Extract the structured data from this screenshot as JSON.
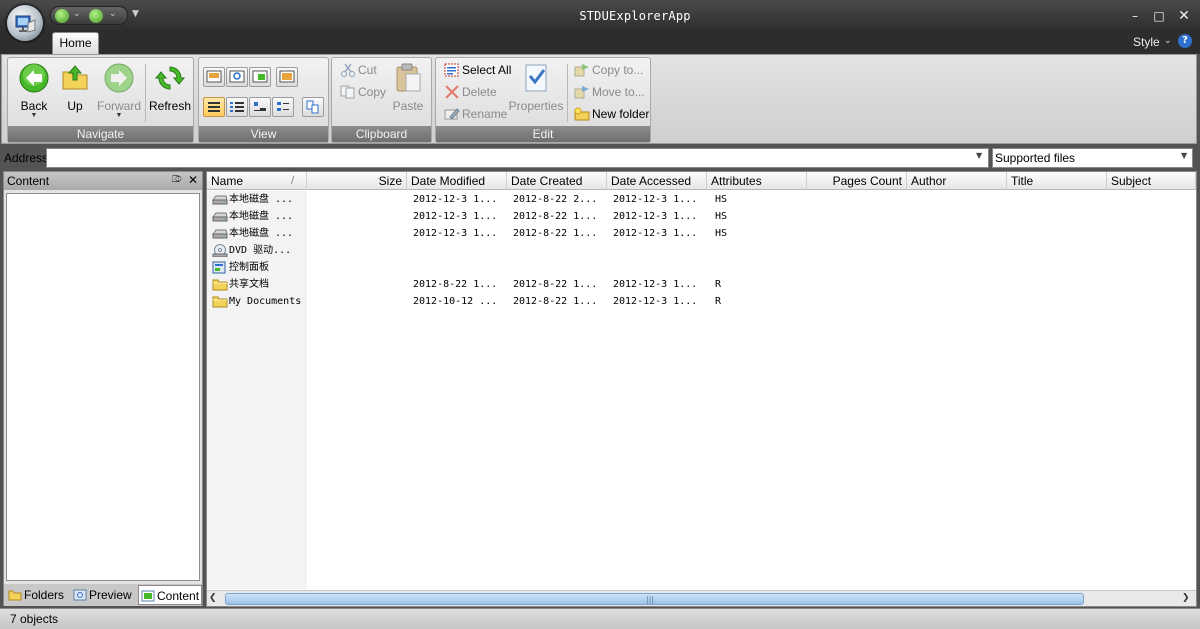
{
  "window": {
    "title": "STDUExplorerApp"
  },
  "ribbon": {
    "tabs": [
      {
        "label": "Home"
      }
    ],
    "style_menu": "Style",
    "groups": {
      "navigate": {
        "label": "Navigate",
        "back": "Back",
        "up": "Up",
        "forward": "Forward",
        "refresh": "Refresh"
      },
      "view": {
        "label": "View"
      },
      "clipboard": {
        "label": "Clipboard",
        "cut": "Cut",
        "copy": "Copy",
        "paste": "Paste"
      },
      "edit": {
        "label": "Edit",
        "select_all": "Select All",
        "delete": "Delete",
        "rename": "Rename",
        "properties": "Properties",
        "copy_to": "Copy to...",
        "move_to": "Move to...",
        "new_folder": "New folder"
      }
    }
  },
  "address": {
    "label": "Address",
    "value": "",
    "filter": "Supported files"
  },
  "left_panel": {
    "title": "Content",
    "tabs": [
      {
        "label": "Folders"
      },
      {
        "label": "Preview"
      },
      {
        "label": "Content"
      }
    ]
  },
  "list": {
    "columns": [
      "Name",
      "Size",
      "Date Modified",
      "Date Created",
      "Date Accessed",
      "Attributes",
      "Pages Count",
      "Author",
      "Title",
      "Subject"
    ],
    "rows": [
      {
        "name": "本地磁盘 ...",
        "size": "",
        "modified": "2012-12-3 1...",
        "created": "2012-8-22 2...",
        "accessed": "2012-12-3 1...",
        "attributes": "HS",
        "icon": "drive-icon"
      },
      {
        "name": "本地磁盘 ...",
        "size": "",
        "modified": "2012-12-3 1...",
        "created": "2012-8-22 1...",
        "accessed": "2012-12-3 1...",
        "attributes": "HS",
        "icon": "drive-icon"
      },
      {
        "name": "本地磁盘 ...",
        "size": "",
        "modified": "2012-12-3 1...",
        "created": "2012-8-22 1...",
        "accessed": "2012-12-3 1...",
        "attributes": "HS",
        "icon": "drive-icon"
      },
      {
        "name": "DVD 驱动...",
        "size": "",
        "modified": "",
        "created": "",
        "accessed": "",
        "attributes": "",
        "icon": "dvd-drive-icon"
      },
      {
        "name": "控制面板",
        "size": "",
        "modified": "",
        "created": "",
        "accessed": "",
        "attributes": "",
        "icon": "control-panel-icon"
      },
      {
        "name": "共享文档",
        "size": "",
        "modified": "2012-8-22 1...",
        "created": "2012-8-22 1...",
        "accessed": "2012-12-3 1...",
        "attributes": "R",
        "icon": "folder-icon"
      },
      {
        "name": "My Documents",
        "size": "",
        "modified": "2012-10-12 ...",
        "created": "2012-8-22 1...",
        "accessed": "2012-12-3 1...",
        "attributes": "R",
        "icon": "folder-icon"
      }
    ]
  },
  "status": {
    "text": "7 objects"
  },
  "colors": {
    "accent": "#2e6fd0",
    "selected_view": "#ffc95c",
    "scroll_thumb": "#9cc2ea"
  }
}
